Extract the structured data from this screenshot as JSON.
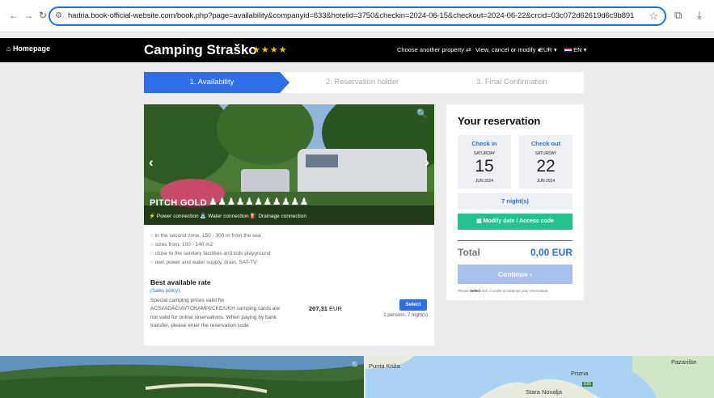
{
  "browser": {
    "url": "hadria.book-official-website.com/book.php?page=availability&companyid=633&hotelid=3750&checkin=2024-06-15&checkout=2024-06-22&crcid=03c072d62619d6c9b891b209457c4a30"
  },
  "header": {
    "home_label": "Homepage",
    "camp_name": "Camping Straško",
    "stars": "★★★★",
    "choose_property": "Choose another property",
    "view_modify": "View, cancel or modify",
    "currency": "EUR ▾",
    "language": "EN ▾"
  },
  "steps": [
    {
      "label": "1.  Availability"
    },
    {
      "label": "2.  Reservation holder"
    },
    {
      "label": "3.  Final Confirmation"
    }
  ],
  "pitch": {
    "name": "PITCH GOLD",
    "persons_icons": "♟♟♟♟♟♟♟♟♟♟♟",
    "amenities": "⚡ Power connection  ⛲ Water connection  ⛽ Drainage connection",
    "features": [
      "○ in the second zone, 150 - 300 m from the sea",
      "○ sizes from: 100 - 140 m2",
      "○ close to the sanitary facilities and kids playground",
      "○ own power and water supply, drain, SAT-TV"
    ],
    "rate_title": "Best available rate",
    "sales_policy": "(Sales policy)",
    "rate_description": "Special camping prices valid for ACSI/ADAC/AVTOKAMPI/CKE/UKH camping cards are not valid for online reservations. When paying by bank transfer, please enter the reservation code",
    "price_amount": "207,31",
    "price_currency": " EUR",
    "select_label": "Select",
    "persons_nights": "1 persons, 7 night(s)"
  },
  "reservation": {
    "title": "Your reservation",
    "checkin": {
      "label": "Check in",
      "dow": "SATURDAY",
      "day": "15",
      "month_year": "JUN 2024"
    },
    "checkout": {
      "label": "Check out",
      "dow": "SATURDAY",
      "day": "22",
      "month_year": "JUN 2024"
    },
    "nights": "7 night(s)",
    "modify_label": "Modify date / Access code",
    "total_label": "Total",
    "total_value": "0,00 EUR",
    "continue_label": "Continue  ›",
    "note_prefix": "Please ",
    "note_bold": "Select",
    "note_suffix": " unit, in order to continue your reservation."
  },
  "map": {
    "labels": [
      "Punta Križa",
      "Prizna",
      "Stara Novalja",
      "Pazarište"
    ],
    "road_badge": "E65"
  },
  "colors": {
    "accent": "#2e6ee8",
    "green_button": "#22c38e",
    "star_gold": "#f2c200"
  }
}
